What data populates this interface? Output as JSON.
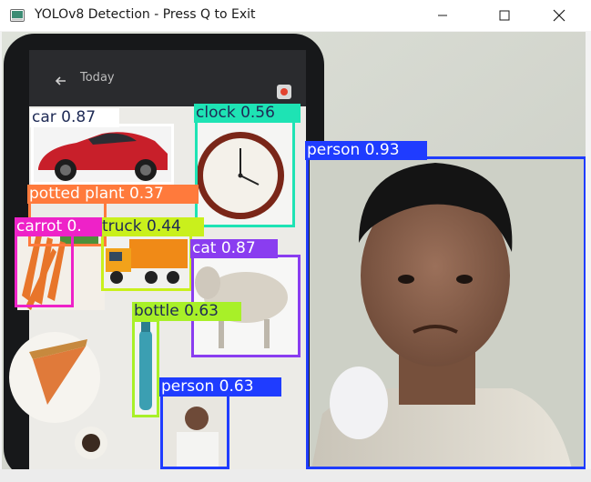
{
  "window": {
    "title": "YOLOv8 Detection - Press Q to Exit",
    "controls": [
      "minimize-icon",
      "maximize-icon",
      "close-icon"
    ]
  },
  "phone_screen": {
    "header_text": "Today",
    "back_icon": "arrow-left-icon",
    "corner_icon": "target-icon"
  },
  "detections": [
    {
      "id": "car",
      "label": "car 0.87",
      "color": "#ffffff",
      "text_color": "#1e2a55"
    },
    {
      "id": "clock",
      "label": "clock 0.56",
      "color": "#1ee3b4",
      "text_color": "#1e2a55"
    },
    {
      "id": "person-main",
      "label": "person 0.93",
      "color": "#1f3cff",
      "text_color": "#ffffff"
    },
    {
      "id": "potted-plant",
      "label": "potted plant 0.37",
      "color": "#ff7a3c",
      "text_color": "#ffffff"
    },
    {
      "id": "carrot",
      "label": "carrot 0.",
      "color": "#ee22c8",
      "text_color": "#ffffff"
    },
    {
      "id": "truck",
      "label": "truck 0.44",
      "color": "#c9f01c",
      "text_color": "#1e2a55"
    },
    {
      "id": "cat",
      "label": "cat 0.87",
      "color": "#8a3df0",
      "text_color": "#ffffff"
    },
    {
      "id": "bottle",
      "label": "bottle 0.63",
      "color": "#a8f028",
      "text_color": "#1e2a55"
    },
    {
      "id": "person-small",
      "label": "person 0.63",
      "color": "#1f3cff",
      "text_color": "#ffffff"
    }
  ]
}
